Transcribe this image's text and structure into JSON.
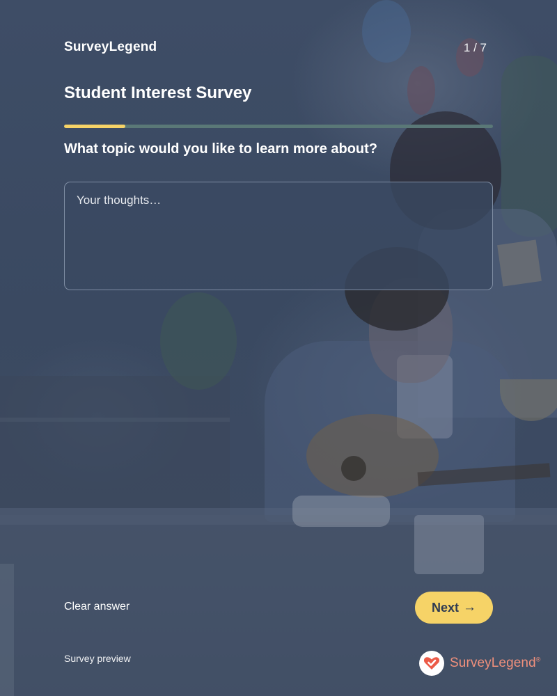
{
  "header": {
    "brand": "SurveyLegend",
    "page_counter": "1 / 7",
    "survey_title": "Student Interest Survey"
  },
  "progress": {
    "current_page": 1,
    "total_pages": 7,
    "fraction": 0.143
  },
  "question": {
    "text": "What topic would you like to learn more about?",
    "answer_value": "",
    "placeholder": "Your thoughts…"
  },
  "actions": {
    "clear_label": "Clear answer",
    "next_label": "Next",
    "next_icon": "arrow-right-icon",
    "next_arrow": "→"
  },
  "footer": {
    "note": "Survey preview",
    "logo_text": "SurveyLegend",
    "logo_mark": "®",
    "logo_icon": "heart-check-icon"
  },
  "colors": {
    "overlay": "#3b4a63",
    "accent_yellow": "#f6d367",
    "progress_track": "#5a7877",
    "logo_coral": "#f0907c"
  }
}
